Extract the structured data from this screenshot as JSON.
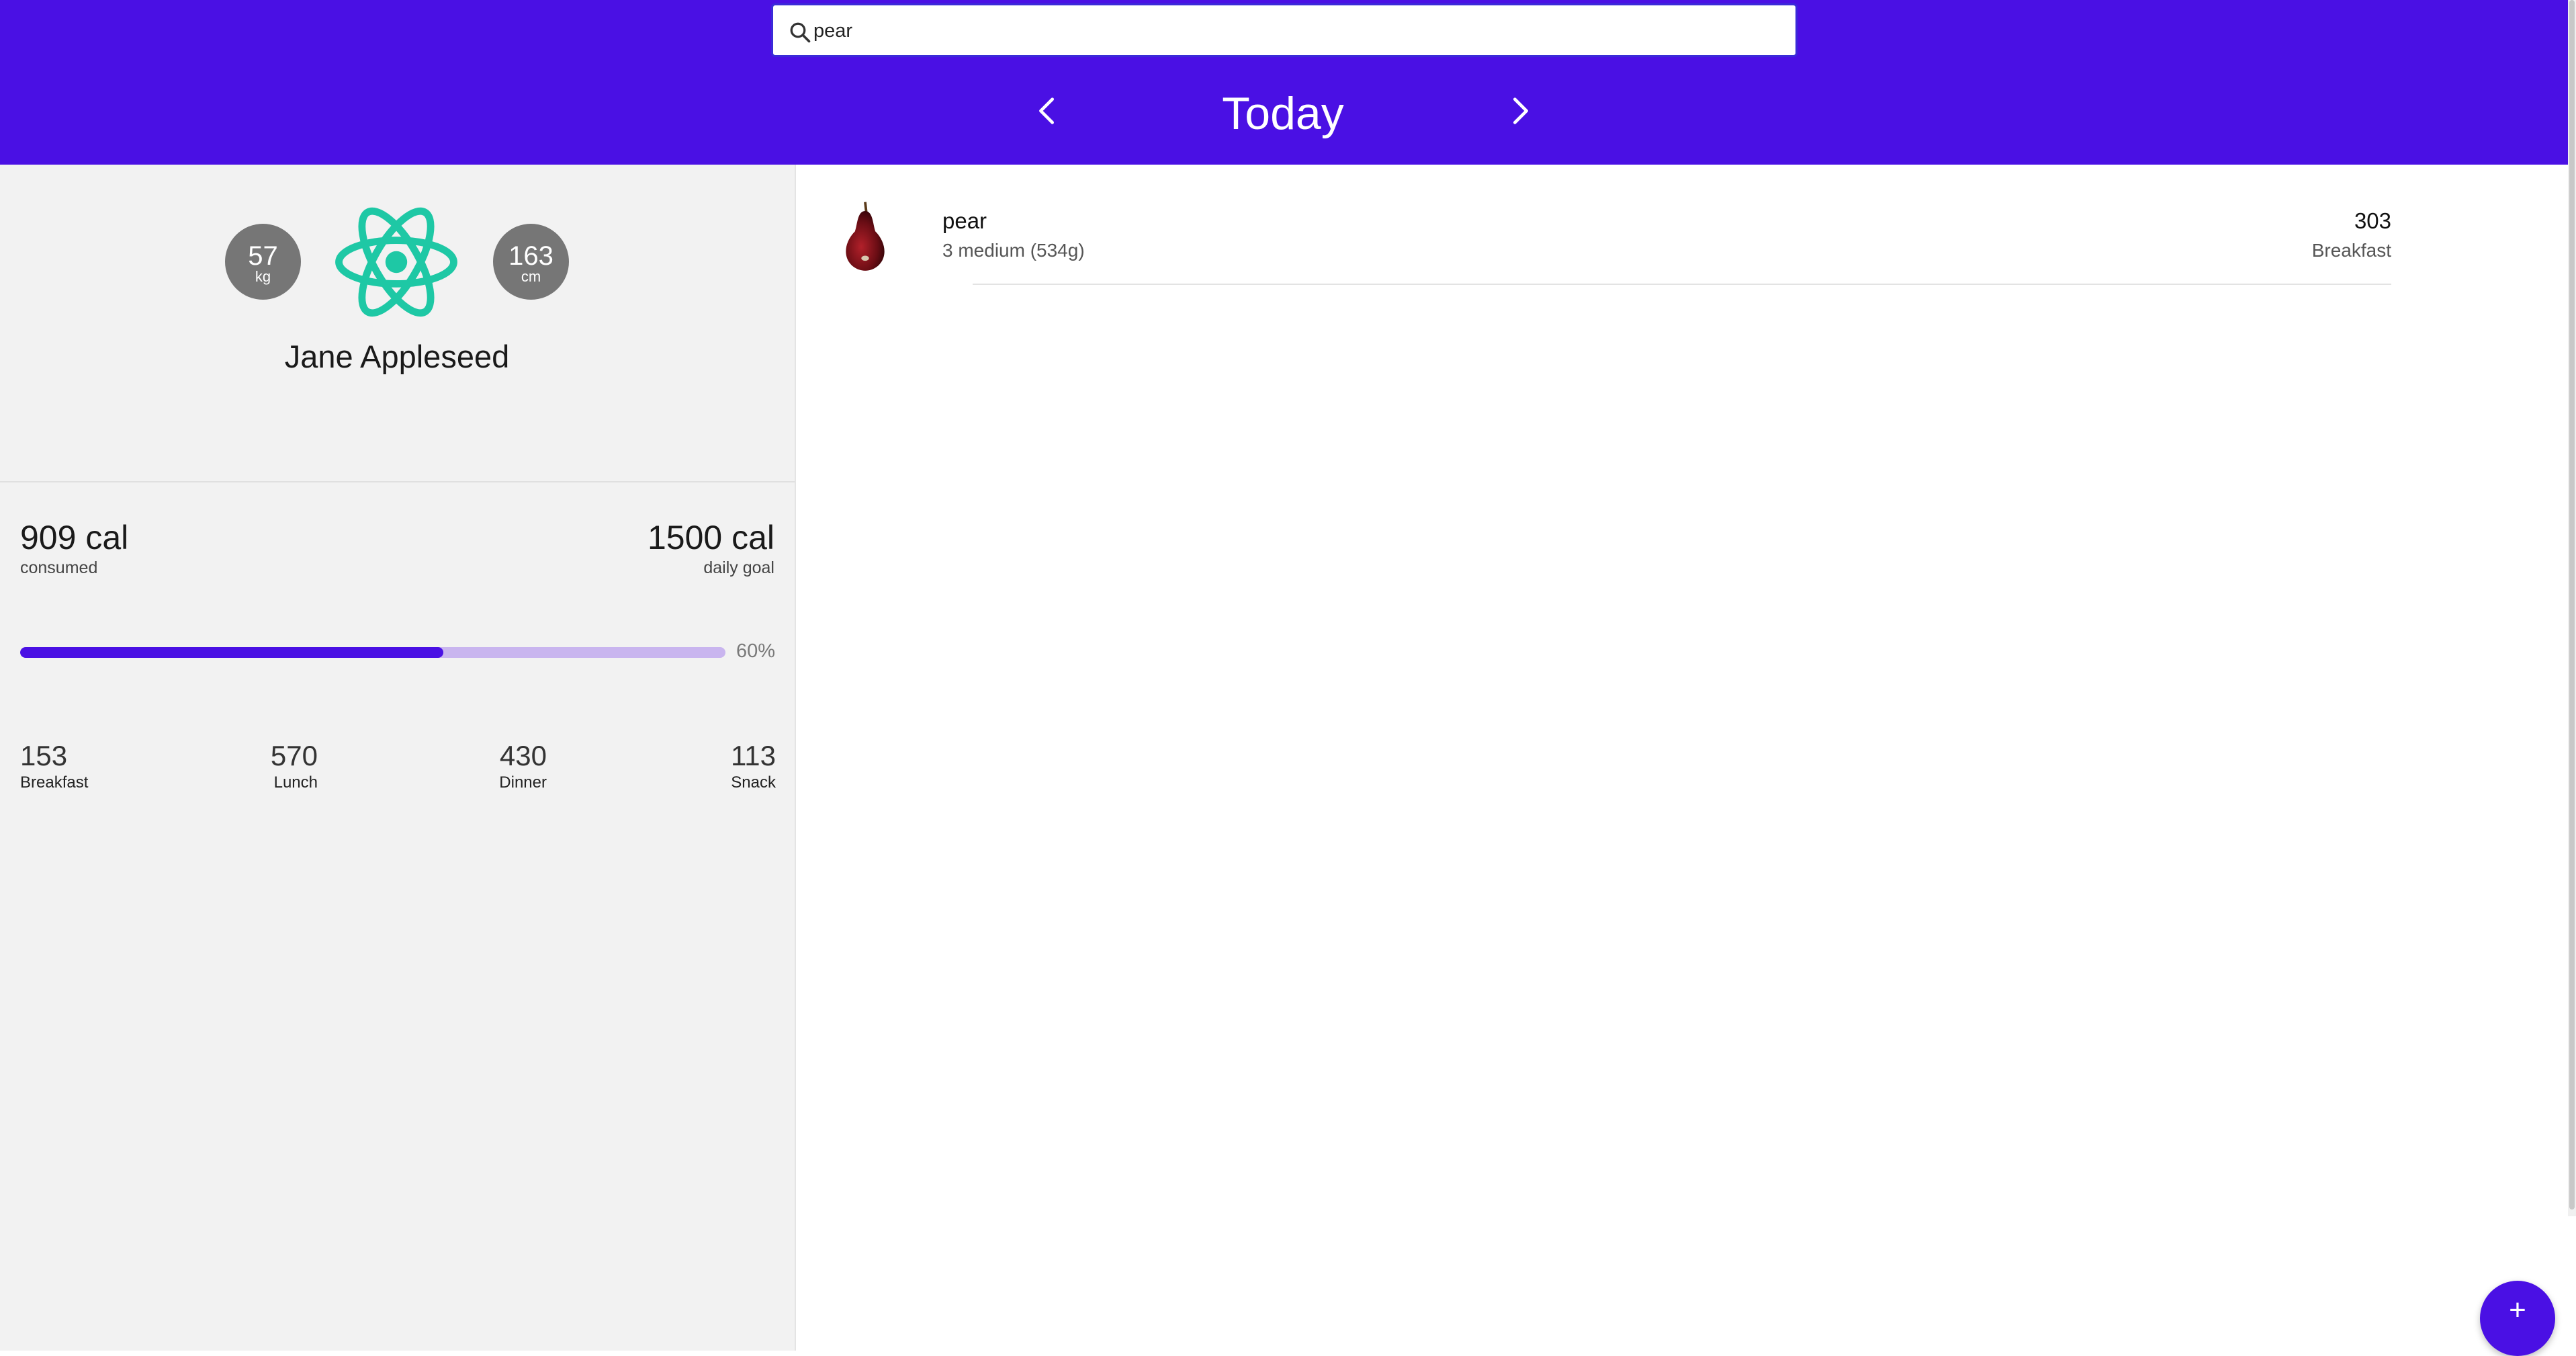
{
  "search": {
    "value": "pear",
    "icon": "search-icon"
  },
  "header": {
    "title": "Today",
    "prev_icon": "chevron-left-icon",
    "next_icon": "chevron-right-icon",
    "color": "#4a10e4"
  },
  "profile": {
    "weight": {
      "value": "57",
      "unit": "kg"
    },
    "height": {
      "value": "163",
      "unit": "cm"
    },
    "logo": "react-logo",
    "name": "Jane Appleseed"
  },
  "calories": {
    "consumed": "909 cal",
    "consumed_label": "consumed",
    "goal": "1500 cal",
    "goal_label": "daily goal",
    "progress_fraction": 0.6,
    "progress_label": "60%"
  },
  "meals": [
    {
      "value": "153",
      "label": "Breakfast"
    },
    {
      "value": "570",
      "label": "Lunch"
    },
    {
      "value": "430",
      "label": "Dinner"
    },
    {
      "value": "113",
      "label": "Snack"
    }
  ],
  "entries": [
    {
      "name": "pear",
      "quantity": "3 medium (534g)",
      "calories": "303",
      "meal": "Breakfast",
      "icon": "pear-icon"
    }
  ],
  "fab": {
    "label": "+",
    "icon": "plus-icon"
  }
}
